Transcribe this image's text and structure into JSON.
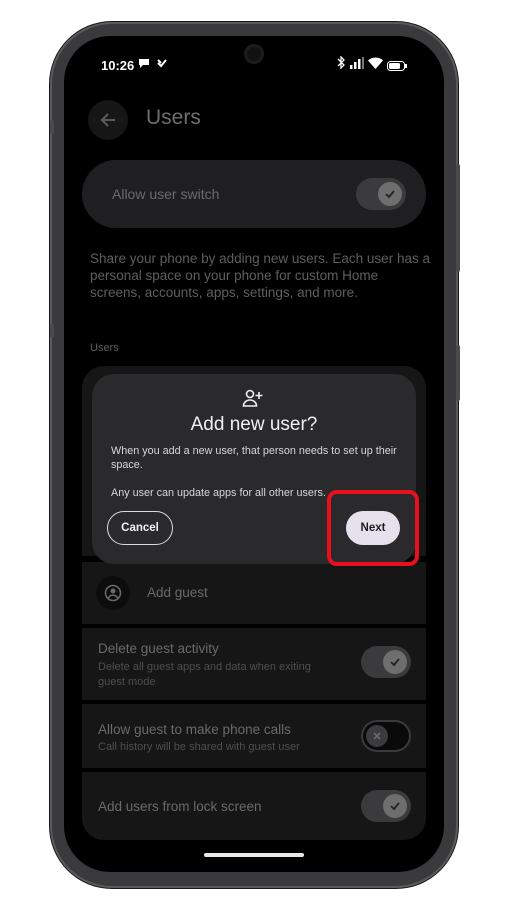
{
  "status_bar": {
    "time": "10:26"
  },
  "header": {
    "title": "Users"
  },
  "allow_switch": {
    "label": "Allow user switch",
    "enabled": true
  },
  "description": "Share your phone by adding new users. Each user has a personal space on your phone for custom Home screens, accounts, apps, settings, and more.",
  "section_label": "Users",
  "add_guest": {
    "label": "Add guest"
  },
  "settings": [
    {
      "title": "Delete guest activity",
      "subtitle": "Delete all guest apps and data when exiting guest mode",
      "enabled": true
    },
    {
      "title": "Allow guest to make phone calls",
      "subtitle": "Call history will be shared with guest user",
      "enabled": false
    },
    {
      "title": "Add users from lock screen",
      "subtitle": "",
      "enabled": true
    }
  ],
  "dialog": {
    "title": "Add new user?",
    "body_1": "When you add a new user, that person needs to set up their space.",
    "body_2": "Any user can update apps for all other users.",
    "cancel_label": "Cancel",
    "next_label": "Next",
    "icon": "person-add-icon"
  },
  "colors": {
    "highlight": "#e8101c",
    "dialog_bg": "#2a2a2c",
    "next_button_bg": "#e6e1ec"
  }
}
